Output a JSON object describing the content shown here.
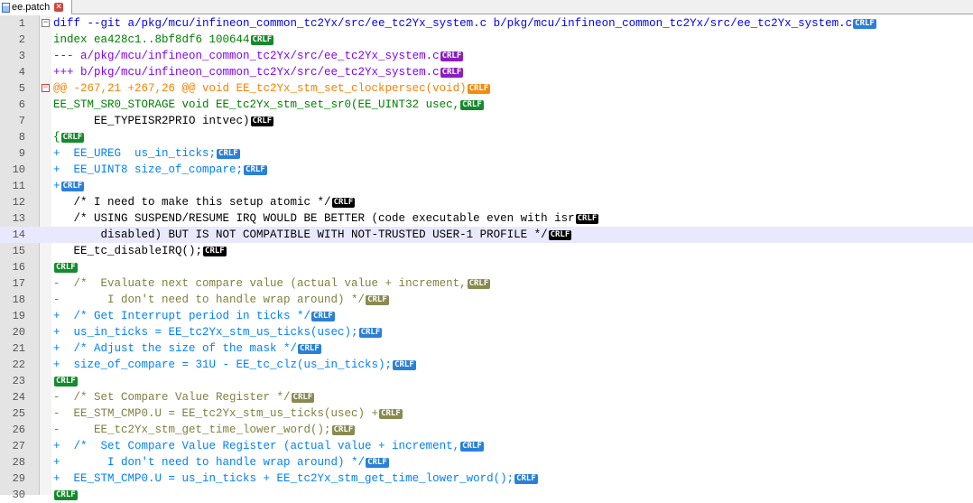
{
  "tab": {
    "label": "ee.patch",
    "icon": "file-icon",
    "close_icon": "close-icon"
  },
  "colors": {
    "header": "#0000ff",
    "index": "#008000",
    "meta": "#8000ff",
    "hunk": "#ff8000",
    "added": "#0080ff",
    "removed": "#808040",
    "context": "#000000"
  },
  "lines": [
    {
      "num": "1",
      "kind": "header",
      "fold": "minus",
      "text": "diff --git a/pkg/mcu/infineon_common_tc2Yx/src/ee_tc2Yx_system.c b/pkg/mcu/infineon_common_tc2Yx/src/ee_tc2Yx_system.c",
      "eol": "CRLF",
      "eolColor": "blue"
    },
    {
      "num": "2",
      "kind": "index",
      "text": "index ea428c1..8bf8df6 100644",
      "eol": "CRLF",
      "eolColor": "green"
    },
    {
      "num": "3",
      "kind": "meta",
      "text": "--- a/pkg/mcu/infineon_common_tc2Yx/src/ee_tc2Yx_system.c",
      "eol": "CRLF",
      "eolColor": "purple"
    },
    {
      "num": "4",
      "kind": "meta",
      "text": "+++ b/pkg/mcu/infineon_common_tc2Yx/src/ee_tc2Yx_system.c",
      "eol": "CRLF",
      "eolColor": "purple"
    },
    {
      "num": "5",
      "kind": "hunk",
      "fold": "minus-red",
      "text": "@@ -267,21 +267,26 @@ void EE_tc2Yx_stm_set_clockpersec(void)",
      "eol": "CRLF",
      "eolColor": "orange"
    },
    {
      "num": "6",
      "kind": "green",
      "text": "EE_STM_SR0_STORAGE void EE_tc2Yx_stm_set_sr0(EE_UINT32 usec,",
      "eol": "CRLF",
      "eolColor": "green"
    },
    {
      "num": "7",
      "kind": "context",
      "text": "      EE_TYPEISR2PRIO intvec)",
      "eol": "CRLF",
      "eolColor": "black"
    },
    {
      "num": "8",
      "kind": "green",
      "text": "{",
      "eol": "CRLF",
      "eolColor": "green"
    },
    {
      "num": "9",
      "kind": "added",
      "text": "+  EE_UREG  us_in_ticks;",
      "eol": "CRLF",
      "eolColor": "blue"
    },
    {
      "num": "10",
      "kind": "added",
      "text": "+  EE_UINT8 size_of_compare;",
      "eol": "CRLF",
      "eolColor": "blue"
    },
    {
      "num": "11",
      "kind": "added",
      "text": "+",
      "eol": "CRLF",
      "eolColor": "blue"
    },
    {
      "num": "12",
      "kind": "context",
      "text": "   /* I need to make this setup atomic */",
      "eol": "CRLF",
      "eolColor": "black"
    },
    {
      "num": "13",
      "kind": "context",
      "text": "   /* USING SUSPEND/RESUME IRQ WOULD BE BETTER (code executable even with isr",
      "eol": "CRLF",
      "eolColor": "black"
    },
    {
      "num": "14",
      "kind": "context",
      "current": true,
      "text": "       disabled) BUT IS NOT COMPATIBLE WITH NOT-TRUSTED USER-1 PROFILE */",
      "eol": "CRLF",
      "eolColor": "black"
    },
    {
      "num": "15",
      "kind": "context",
      "text": "   EE_tc_disableIRQ();",
      "eol": "CRLF",
      "eolColor": "black"
    },
    {
      "num": "16",
      "kind": "green",
      "text": "",
      "eol": "CRLF",
      "eolColor": "green"
    },
    {
      "num": "17",
      "kind": "removed",
      "text": "-  /*  Evaluate next compare value (actual value + increment,",
      "eol": "CRLF",
      "eolColor": "olive"
    },
    {
      "num": "18",
      "kind": "removed",
      "text": "-       I don't need to handle wrap around) */",
      "eol": "CRLF",
      "eolColor": "olive"
    },
    {
      "num": "19",
      "kind": "added",
      "text": "+  /* Get Interrupt period in ticks */",
      "eol": "CRLF",
      "eolColor": "blue"
    },
    {
      "num": "20",
      "kind": "added",
      "text": "+  us_in_ticks = EE_tc2Yx_stm_us_ticks(usec);",
      "eol": "CRLF",
      "eolColor": "blue"
    },
    {
      "num": "21",
      "kind": "added",
      "text": "+  /* Adjust the size of the mask */",
      "eol": "CRLF",
      "eolColor": "blue"
    },
    {
      "num": "22",
      "kind": "added",
      "text": "+  size_of_compare = 31U - EE_tc_clz(us_in_ticks);",
      "eol": "CRLF",
      "eolColor": "blue"
    },
    {
      "num": "23",
      "kind": "green",
      "text": "",
      "eol": "CRLF",
      "eolColor": "green"
    },
    {
      "num": "24",
      "kind": "removed",
      "text": "-  /* Set Compare Value Register */",
      "eol": "CRLF",
      "eolColor": "olive"
    },
    {
      "num": "25",
      "kind": "removed",
      "text": "-  EE_STM_CMP0.U = EE_tc2Yx_stm_us_ticks(usec) +",
      "eol": "CRLF",
      "eolColor": "olive"
    },
    {
      "num": "26",
      "kind": "removed",
      "text": "-     EE_tc2Yx_stm_get_time_lower_word();",
      "eol": "CRLF",
      "eolColor": "olive"
    },
    {
      "num": "27",
      "kind": "added",
      "text": "+  /*  Set Compare Value Register (actual value + increment,",
      "eol": "CRLF",
      "eolColor": "blue"
    },
    {
      "num": "28",
      "kind": "added",
      "text": "+       I don't need to handle wrap around) */",
      "eol": "CRLF",
      "eolColor": "blue"
    },
    {
      "num": "29",
      "kind": "added",
      "text": "+  EE_STM_CMP0.U = us_in_ticks + EE_tc2Yx_stm_get_time_lower_word();",
      "eol": "CRLF",
      "eolColor": "blue"
    },
    {
      "num": "30",
      "kind": "green",
      "text": "",
      "eol": "CRLF",
      "eolColor": "green"
    }
  ]
}
